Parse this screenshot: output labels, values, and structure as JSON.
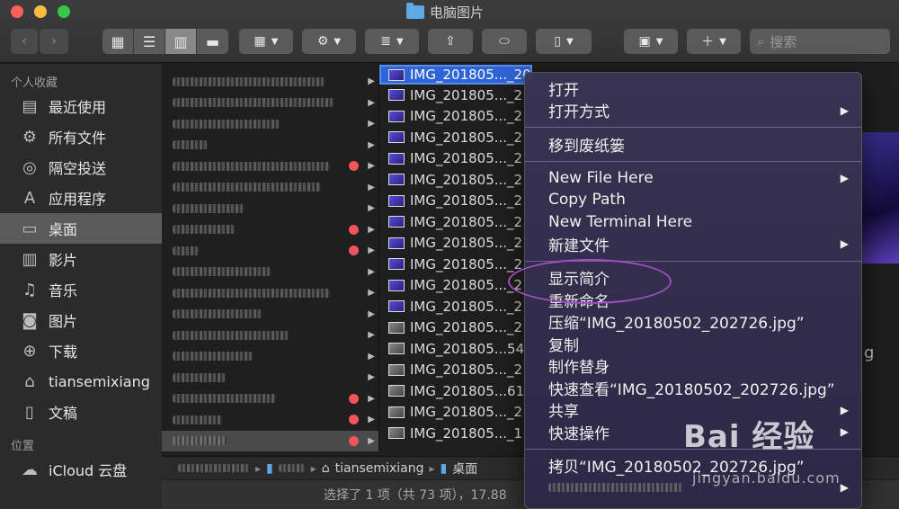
{
  "window": {
    "title": "电脑图片"
  },
  "toolbar": {
    "search_placeholder": "搜索"
  },
  "sidebar": {
    "favorites_header": "个人收藏",
    "items": [
      {
        "label": "最近使用",
        "icon": "recent-icon"
      },
      {
        "label": "所有文件",
        "icon": "gear-icon"
      },
      {
        "label": "隔空投送",
        "icon": "airdrop-icon"
      },
      {
        "label": "应用程序",
        "icon": "apps-icon"
      },
      {
        "label": "桌面",
        "icon": "desktop-icon",
        "selected": true
      },
      {
        "label": "影片",
        "icon": "film-icon"
      },
      {
        "label": "音乐",
        "icon": "music-icon"
      },
      {
        "label": "图片",
        "icon": "camera-icon"
      },
      {
        "label": "下载",
        "icon": "download-icon"
      },
      {
        "label": "tiansemixiang",
        "icon": "home-icon"
      },
      {
        "label": "文稿",
        "icon": "document-icon"
      }
    ],
    "locations_header": "位置",
    "locations": [
      {
        "label": "iCloud 云盘",
        "icon": "cloud-icon"
      }
    ]
  },
  "files": [
    "IMG_201805..._202726.jpg",
    "IMG_201805..._2",
    "IMG_201805..._2",
    "IMG_201805..._2",
    "IMG_201805..._2",
    "IMG_201805..._2",
    "IMG_201805..._2",
    "IMG_201805..._2",
    "IMG_201805..._2",
    "IMG_201805..._2",
    "IMG_201805..._2",
    "IMG_201805..._2",
    "IMG_201805..._2",
    "IMG_201805...54",
    "IMG_201805..._2",
    "IMG_201805...61",
    "IMG_201805..._2",
    "IMG_201805..._1"
  ],
  "pathbar": {
    "user": "tiansemixiang",
    "desktop": "桌面"
  },
  "status": "选择了 1 项（共 73 项），17.88",
  "context_menu": {
    "open": "打开",
    "open_with": "打开方式",
    "trash": "移到废纸篓",
    "new_file_here": "New File Here",
    "copy_path": "Copy Path",
    "new_terminal_here": "New Terminal Here",
    "new_file_cn": "新建文件",
    "get_info": "显示简介",
    "rename": "重新命名",
    "compress": "压缩“IMG_20180502_202726.jpg”",
    "duplicate": "复制",
    "make_alias": "制作替身",
    "quick_look": "快速查看“IMG_20180502_202726.jpg”",
    "share": "共享",
    "quick_actions": "快速操作",
    "copy_item": "拷贝“IMG_20180502_202726.jpg”"
  },
  "watermark": {
    "brand": "Bai 经验",
    "url": "jingyan.baidu.com"
  },
  "preview": {
    "partial_text": "g"
  }
}
